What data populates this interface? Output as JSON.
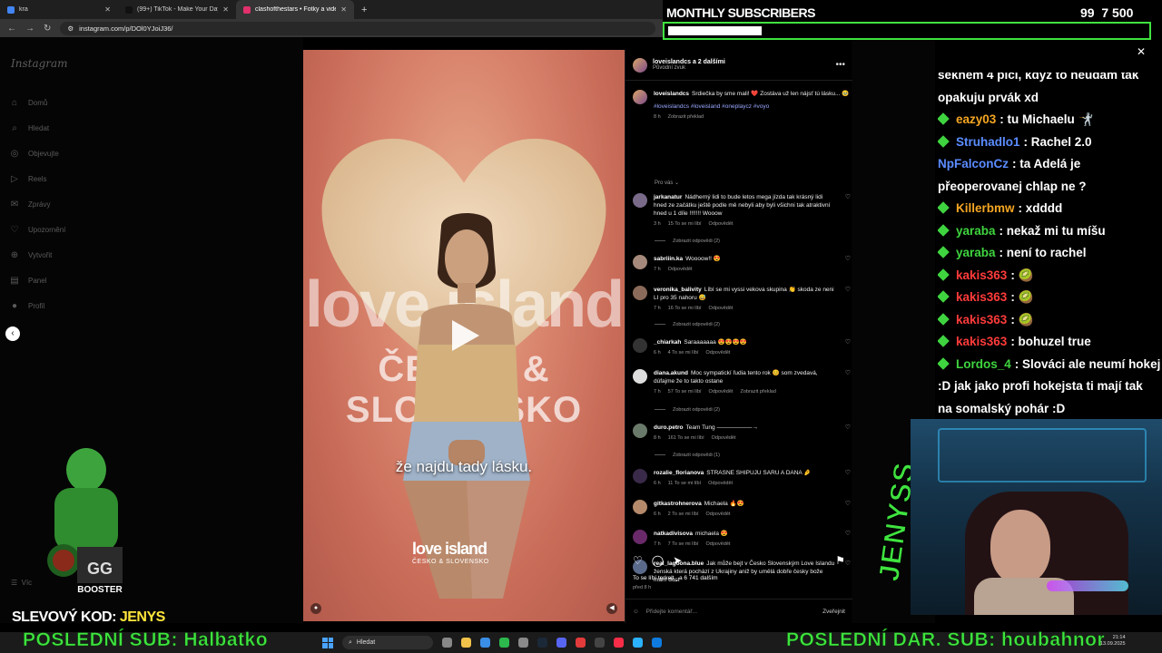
{
  "browser": {
    "tabs": [
      {
        "label": "kra",
        "color": "#4285f4",
        "active": false
      },
      {
        "label": "(99+) TikTok - Make Your Day",
        "color": "#111111",
        "active": false
      },
      {
        "label": "clashofthestars • Fotky a videa",
        "color": "#e1306c",
        "active": true
      }
    ],
    "url": "instagram.com/p/DOl0YJoiJ36/"
  },
  "instagram": {
    "logo": "Instagram",
    "nav": [
      "Domů",
      "Hledat",
      "Objevujte",
      "Reels",
      "Zprávy",
      "Upozornění",
      "Vytvořit",
      "Panel",
      "Profil"
    ],
    "more": "Víc"
  },
  "post": {
    "header_user": "loveislandcs a 2 dalšími",
    "header_sub": "Původní zvuk",
    "video_subtitle": "že najdu tady lásku.",
    "video_logo_1": "love island",
    "video_logo_2": "ČESKO & SLOVENSKO",
    "caption_user": "loveislandcs",
    "caption_text": "Srdiečka by sme mali! ❤️ Zostáva už len nájsť tú lásku... 🥹",
    "hashtags": "#loveislandcs #loveisland #oneplaycz #voyo",
    "caption_time": "8 h",
    "caption_translate": "Zobrazit překlad",
    "for_you": "Pro vás ⌄",
    "likes": "To se líbí terkelt_ a 6 741 dalším",
    "ago": "před 8 h",
    "add_comment": "Přidejte komentář...",
    "post_btn": "Zveřejnit"
  },
  "comments": [
    {
      "user": "jarkanatur",
      "text": "Nádherný lidi to bude letos mega jízda tak krásný lidi hned ze začátku ještě podle mě nebyli aby byli všichni tak atraktivní hned u 1 díle !!!!!!! Wooow",
      "time": "3 h",
      "likes": "15 To se mi líbí",
      "reply": "Odpovědět",
      "replies": "Zobrazit odpovědi (2)",
      "color": "#7a6a8a"
    },
    {
      "user": "sabriiin.ka",
      "text": "Woooow!! 😍",
      "time": "7 h",
      "likes": "",
      "reply": "Odpovědět",
      "replies": "",
      "color": "#a5897a"
    },
    {
      "user": "veronika_balivity",
      "text": "Líbí se mi vyssi vekova skupina 👏 skoda ze neni LI pro 35 nahoru 😅",
      "time": "7 h",
      "likes": "16 To se mi líbí",
      "reply": "Odpovědět",
      "replies": "Zobrazit odpovědi (2)",
      "color": "#8a6a5a"
    },
    {
      "user": "_chiarkah",
      "text": "Saraaaaaaa 😍😍😍😍",
      "time": "6 h",
      "likes": "4 To se mi líbí",
      "reply": "Odpovědět",
      "replies": "",
      "color": "#333333"
    },
    {
      "user": "diana.akund",
      "text": "Moc sympatickí ľudia tento rok 😊 som zvedavá, dúfajme že to takto ostane",
      "time": "7 h",
      "likes": "57 To se mi líbí",
      "reply": "Odpovědět",
      "translate": "Zobrazit překlad",
      "replies": "Zobrazit odpovědi (2)",
      "color": "#dddddd"
    },
    {
      "user": "duro.petro",
      "text": "Team Tung ——————→",
      "time": "8 h",
      "likes": "161 To se mi líbí",
      "reply": "Odpovědět",
      "replies": "Zobrazit odpovědi (1)",
      "color": "#6a7a6a"
    },
    {
      "user": "rozalie_florianova",
      "text": "STRASNE SHIPUJU SARU A DANA 🤌",
      "time": "6 h",
      "likes": "11 To se mi líbí",
      "reply": "Odpovědět",
      "replies": "",
      "color": "#3a2a4a"
    },
    {
      "user": "gitkastrohnerova",
      "text": "Michaela 🔥😍",
      "time": "6 h",
      "likes": "2 To se mi líbí",
      "reply": "Odpovědět",
      "replies": "",
      "color": "#b58a6a"
    },
    {
      "user": "natkadivisova",
      "text": "michaela 😍",
      "time": "7 h",
      "likes": "7 To se mi líbí",
      "reply": "Odpovědět",
      "replies": "",
      "color": "#6a2a6a"
    },
    {
      "user": "real_lagoona.blue",
      "text": "Jak může bejt v Česko Slovenským Love Islandu ženská která pochází z Ukrajiny aniž by umělá dobře česky bože mám dost",
      "time": "",
      "likes": "",
      "reply": "",
      "replies": "",
      "color": "#5a6a8a"
    }
  ],
  "overlay": {
    "subs_title": "MONTHLY SUBSCRIBERS",
    "subs_count": "99",
    "subs_goal": "7 500",
    "subs_progress": 0.013,
    "chat": [
      {
        "user": "",
        "user_color": "#ffffff",
        "text": "seknem 4 plci, když to neudám tak",
        "badge": false
      },
      {
        "user": "",
        "user_color": "#ffffff",
        "text": "opakuju prvák xd",
        "badge": false
      },
      {
        "user": "eazy03",
        "user_color": "#f5a623",
        "text": ": tu Michaelu 🤺",
        "badge": true
      },
      {
        "user": "Struhadlo1",
        "user_color": "#5b8cff",
        "text": ": Rachel 2.0",
        "badge": true
      },
      {
        "user": "NpFalconCz",
        "user_color": "#5b8cff",
        "text": ": ta Adelá je",
        "badge": false
      },
      {
        "user": "",
        "user_color": "#ffffff",
        "text": "přeoperovanej chlap ne ?",
        "badge": false
      },
      {
        "user": "Killerbmw",
        "user_color": "#f5a623",
        "text": ": xdddd",
        "badge": true
      },
      {
        "user": "yaraba",
        "user_color": "#3fd43f",
        "text": ": nekaž mi tu míšu",
        "badge": true
      },
      {
        "user": "yaraba",
        "user_color": "#3fd43f",
        "text": ": není to rachel",
        "badge": true
      },
      {
        "user": "kakis363",
        "user_color": "#ff3b3b",
        "text": ": 🥝",
        "badge": true
      },
      {
        "user": "kakis363",
        "user_color": "#ff3b3b",
        "text": ": 🥝",
        "badge": true
      },
      {
        "user": "kakis363",
        "user_color": "#ff3b3b",
        "text": ": 🥝",
        "badge": true
      },
      {
        "user": "kakis363",
        "user_color": "#ff3b3b",
        "text": ": bohuzel true",
        "badge": true
      },
      {
        "user": "Lordos_4",
        "user_color": "#3fd43f",
        "text": ": Slováci ale neumí hokej",
        "badge": true
      },
      {
        "user": "",
        "user_color": "#ffffff",
        "text": ":D jak jako profi hokejsta ti mají tak",
        "badge": false
      },
      {
        "user": "",
        "user_color": "#ffffff",
        "text": "na somalský pohár :D",
        "badge": false
      }
    ],
    "side_name": "JENYSS",
    "promo_label": "SLEVOVÝ KOD:",
    "promo_code": "JENYS",
    "last_sub": "POSLEDNÍ SUB: Halbatko",
    "last_dar": "POSLEDNÍ DAR. SUB: houbahnor"
  },
  "taskbar": {
    "search": "Hledat",
    "time": "21:14",
    "date": "13.09.2025"
  },
  "colors": {
    "accent_green": "#3fe33f",
    "promo_yellow": "#ffe63b",
    "ig_link": "#9aa8ff"
  }
}
